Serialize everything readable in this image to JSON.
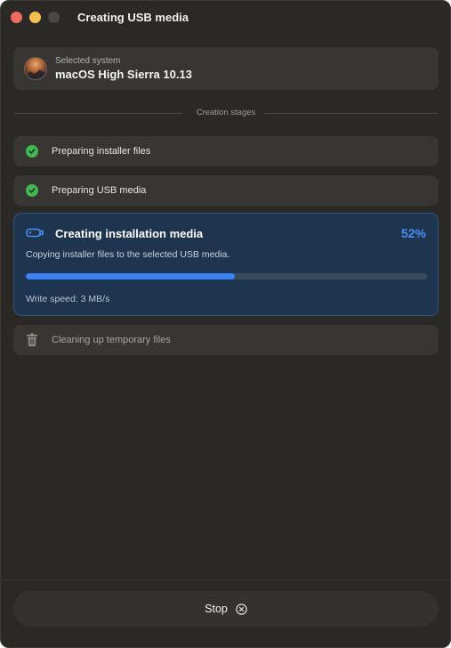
{
  "window": {
    "title": "Creating USB media"
  },
  "system": {
    "label": "Selected system",
    "name": "macOS High Sierra 10.13"
  },
  "stages_header": "Creation stages",
  "stages": [
    {
      "label": "Preparing installer files",
      "status": "done",
      "icon": "check-circle-icon"
    },
    {
      "label": "Preparing USB media",
      "status": "done",
      "icon": "check-circle-icon"
    },
    {
      "label": "Creating installation media",
      "status": "in-progress",
      "icon": "usb-drive-icon",
      "percent_label": "52%",
      "progress": 0.52,
      "description": "Copying installer files to the selected USB media.",
      "write_speed": "Write speed: 3 MB/s"
    },
    {
      "label": "Cleaning up temporary files",
      "status": "pending",
      "icon": "trash-icon"
    }
  ],
  "footer": {
    "stop_label": "Stop",
    "stop_icon": "close-circle-icon"
  },
  "colors": {
    "accent": "#3b82f6",
    "success": "#3fb950",
    "active_bg": "#1e3550",
    "window_bg": "#2b2926"
  }
}
